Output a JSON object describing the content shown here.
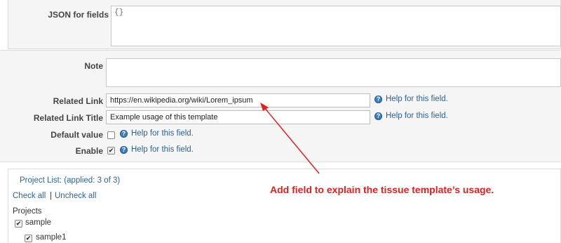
{
  "json_fields": {
    "label": "JSON for fields",
    "value": "{}"
  },
  "note": {
    "label": "Note",
    "value": ""
  },
  "related_link": {
    "label": "Related Link",
    "value": "https://en.wikipedia.org/wiki/Lorem_ipsum",
    "help": "Help for this field."
  },
  "related_link_title": {
    "label": "Related Link Title",
    "value": "Example usage of this template",
    "help": "Help for this field."
  },
  "default_value": {
    "label": "Default value",
    "checked": false,
    "help": "Help for this field."
  },
  "enable": {
    "label": "Enable",
    "checked": true,
    "help": "Help for this field."
  },
  "project_list": {
    "title": "Project List: (applied: 3 of 3)",
    "check_all": "Check all",
    "separator": "|",
    "uncheck_all": "Uncheck all",
    "heading": "Projects",
    "items": [
      {
        "label": "sample",
        "checked": true
      },
      {
        "label": "sample1",
        "checked": true
      }
    ]
  },
  "annotation": {
    "text": "Add field to explain the tissue template’s usage.",
    "color": "#e02020"
  },
  "icons": {
    "help": "help-circle-icon",
    "check": "checkmark-icon"
  },
  "colors": {
    "link": "#2a6496",
    "help_icon": "#3c7bbf",
    "panel": "#f5f5f5"
  }
}
